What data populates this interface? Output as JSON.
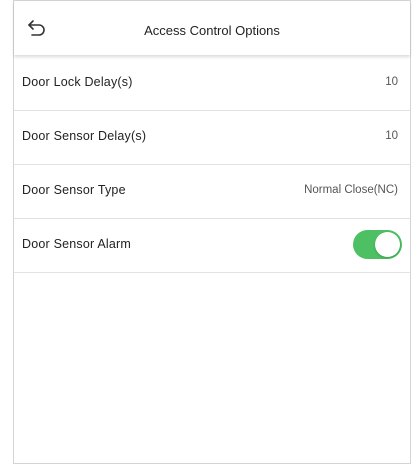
{
  "header": {
    "title": "Access Control Options",
    "back_icon": "back-arrow-icon"
  },
  "settings": [
    {
      "label": "Door Lock Delay(s)",
      "value": "10"
    },
    {
      "label": "Door Sensor Delay(s)",
      "value": "10"
    },
    {
      "label": "Door Sensor Type",
      "value": "Normal Close(NC)"
    },
    {
      "label": "Door Sensor Alarm",
      "toggle_on": true
    }
  ],
  "colors": {
    "toggle_on": "#4cc063",
    "divider": "#e2e2e2"
  }
}
